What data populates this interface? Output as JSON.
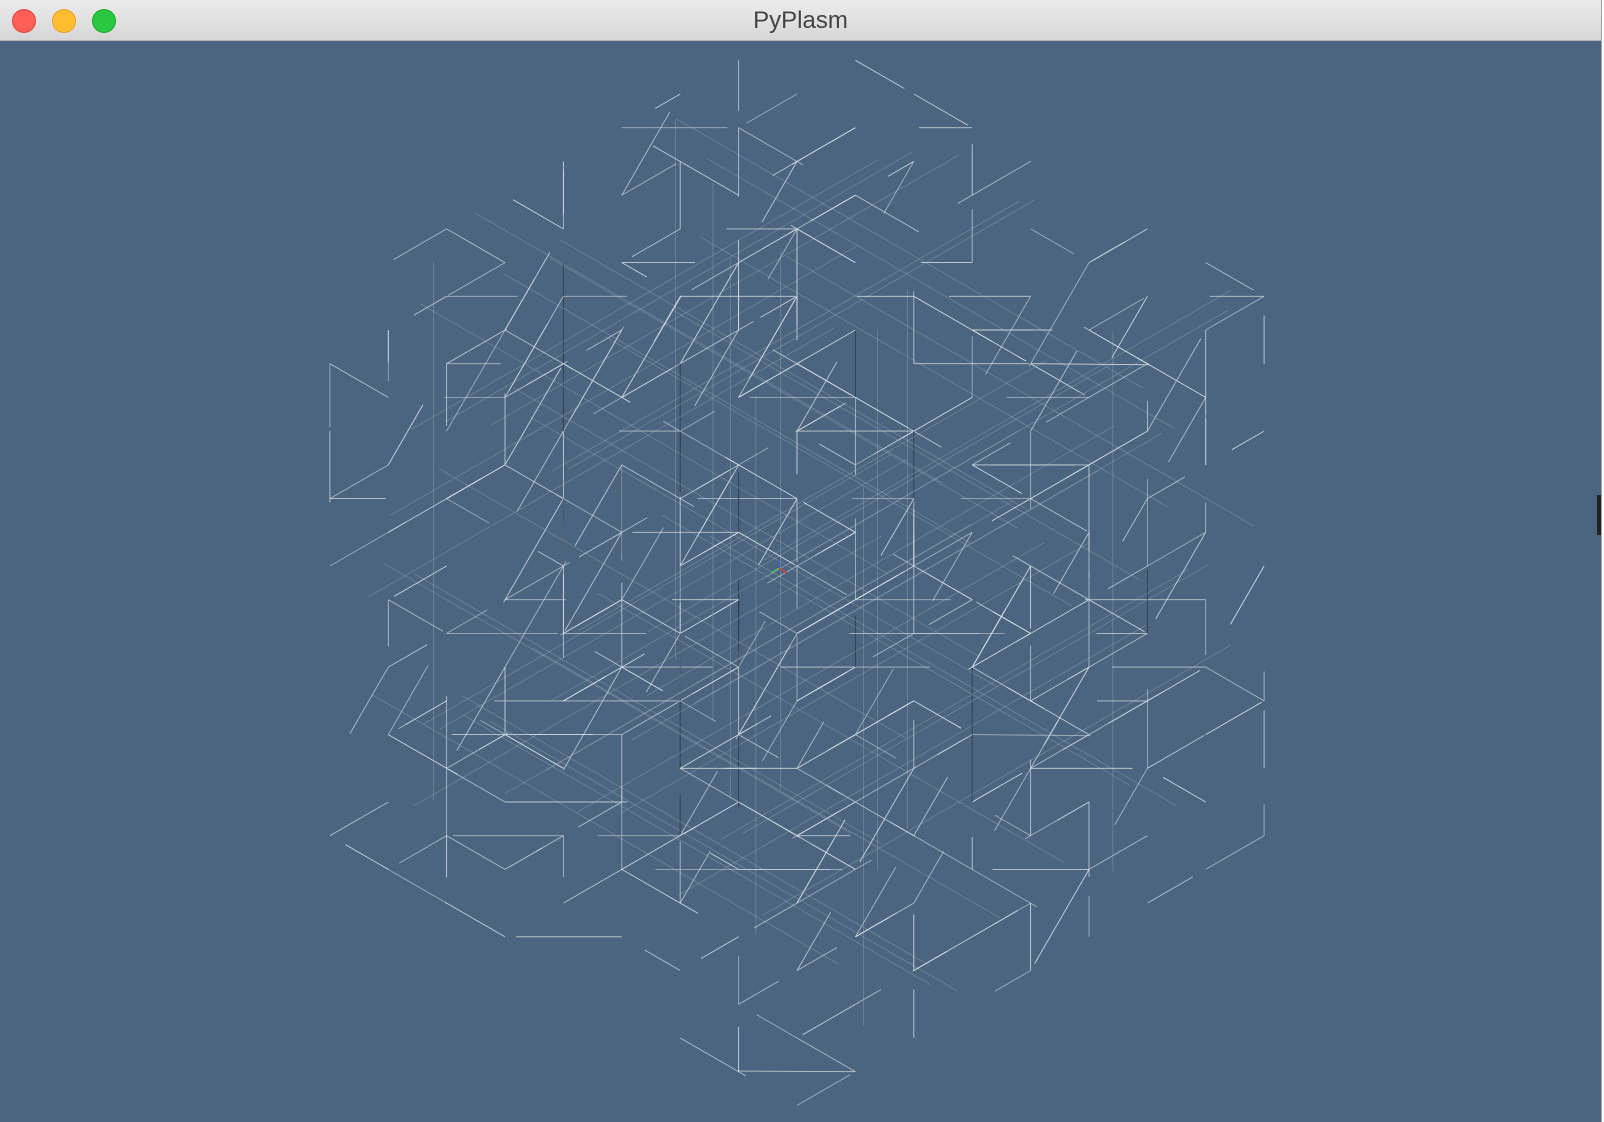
{
  "window": {
    "title": "PyPlasm",
    "background_color": "#4b6580",
    "controls": {
      "close_icon": "close-icon",
      "minimize_icon": "minimize-icon",
      "zoom_icon": "zoom-icon",
      "close_color": "#ff5f57",
      "minimize_color": "#ffbd2e",
      "zoom_color": "#28c940"
    }
  },
  "scene": {
    "object": "wireframe-cube",
    "line_color": "#d8dde2",
    "shadow_line_color": "#2f3c48",
    "axis_colors": {
      "x": "#d03b3b",
      "y": "#3bbf55",
      "z": "#3b5bd0"
    }
  }
}
